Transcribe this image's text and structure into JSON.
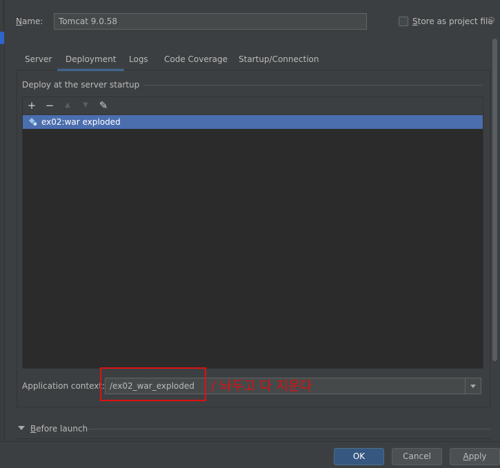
{
  "config": {
    "name_label_mnemonic": "N",
    "name_label_rest": "ame:",
    "name_value": "Tomcat 9.0.58",
    "store_label_mnemonic": "S",
    "store_label_rest": "tore as project file",
    "store_checked": false
  },
  "tabs": [
    {
      "label": "Server",
      "active": false
    },
    {
      "label": "Deployment",
      "active": true
    },
    {
      "label": "Logs",
      "active": false
    },
    {
      "label": "Code Coverage",
      "active": false
    },
    {
      "label": "Startup/Connection",
      "active": false
    }
  ],
  "deployment": {
    "group_title": "Deploy at the server startup",
    "toolbar": {
      "add": "+",
      "remove": "−",
      "move_up": "▲",
      "move_down": "▼",
      "edit": "✎"
    },
    "artifacts": [
      {
        "label": "ex02:war exploded",
        "selected": true
      }
    ],
    "app_context_label": "Application context:",
    "app_context_value": "/ex02_war_exploded",
    "annotation_text": "/ 놔두고 다 지운다",
    "annotation_color": "#e01010"
  },
  "before_launch": {
    "mnemonic": "B",
    "rest": "efore launch",
    "expanded": true
  },
  "buttons": {
    "ok": "OK",
    "cancel": "Cancel",
    "apply_mnemonic": "A",
    "apply_rest": "pply"
  },
  "colors": {
    "background": "#3c3f41",
    "selection": "#4b6eaf",
    "accent": "#4a88c7",
    "primary_button": "#365880"
  },
  "icons": {
    "settings": "gear-icon",
    "artifact": "artifact-icon",
    "expand": "triangle-down-icon"
  }
}
